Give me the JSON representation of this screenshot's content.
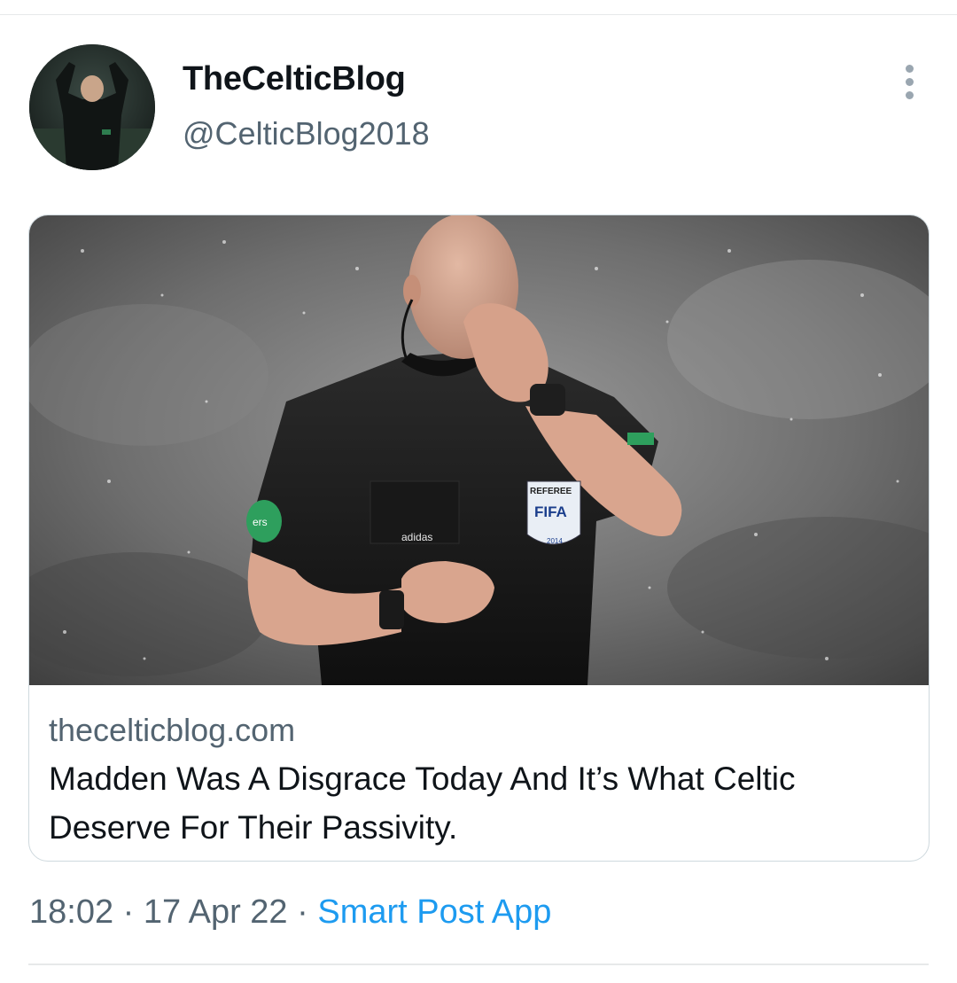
{
  "tweet": {
    "author": {
      "name": "TheCelticBlog",
      "handle": "@CelticBlog2018"
    },
    "card": {
      "domain": "thecelticblog.com",
      "title": "Madden Was A Disgrace Today And It’s What Celtic Deserve For Their Passivity.",
      "image": {
        "badge_top": "REFEREE",
        "badge_main": "FIFA",
        "badge_year": "2014",
        "kit_brand": "adidas",
        "sleeve_text": "ers"
      }
    },
    "meta": {
      "time": "18:02",
      "separator": "·",
      "date": "17 Apr 22",
      "source": "Smart Post App"
    }
  },
  "icons": {
    "more": "more-vertical-icon"
  },
  "colors": {
    "text_primary": "#0f1419",
    "text_secondary": "#536471",
    "link": "#1d9bf0",
    "border": "#cfd9de"
  }
}
